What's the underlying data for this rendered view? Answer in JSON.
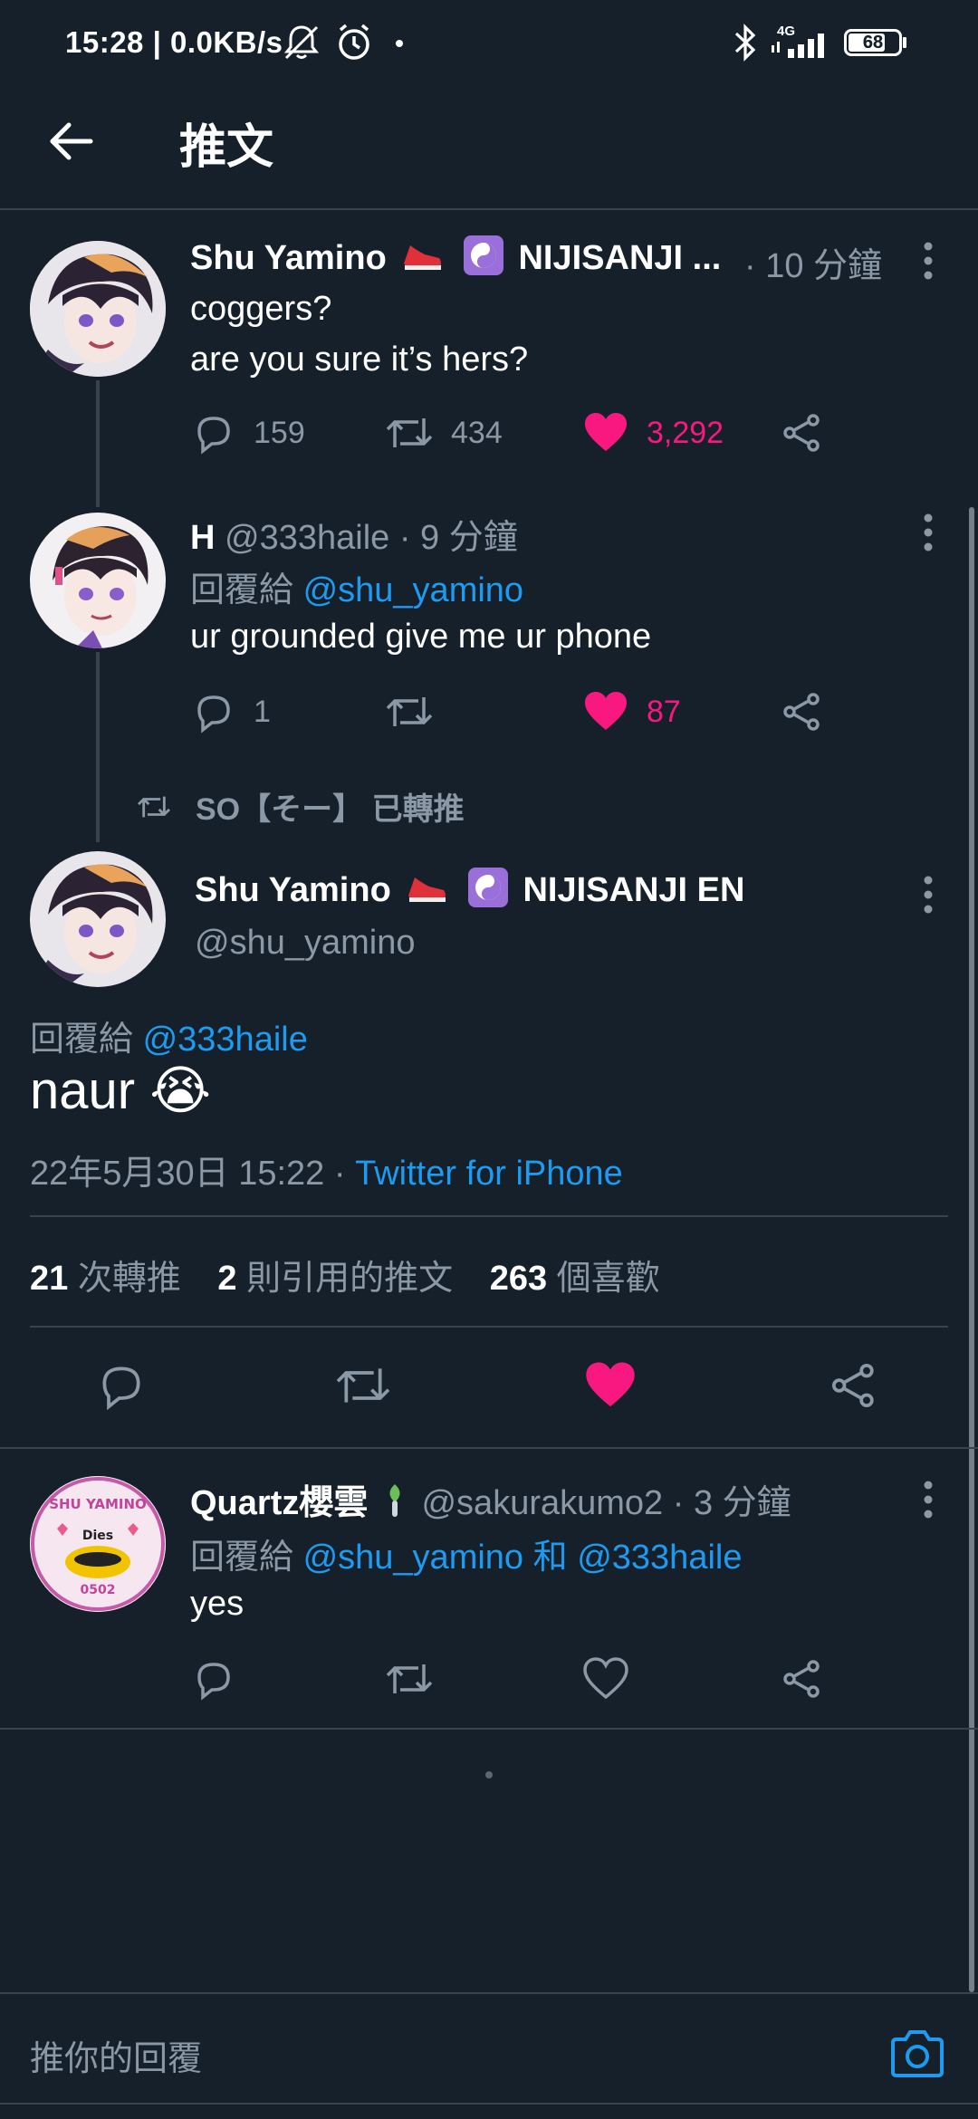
{
  "status_bar": {
    "time": "15:28 | 0.0KB/s",
    "network": "4G",
    "battery": "68"
  },
  "header": {
    "title": "推文"
  },
  "tweets": [
    {
      "name": "Shu Yamino",
      "name_suffix": "NIJISANJI ...",
      "time": "· 10 分鐘",
      "line1": "coggers?",
      "line2": "are you sure it’s hers?",
      "replies": "159",
      "retweets": "434",
      "likes": "3,292"
    },
    {
      "name": "H",
      "handle": "@333haile",
      "time": "· 9 分鐘",
      "reply_prefix": "回覆給",
      "reply_to": "@shu_yamino",
      "text": "ur grounded give me ur phone",
      "replies": "1",
      "likes": "87"
    }
  ],
  "retweet_banner": "SO【そー】 已轉推",
  "main_tweet": {
    "name": "Shu Yamino",
    "name_suffix": "NIJISANJI EN",
    "handle": "@shu_yamino",
    "reply_prefix": "回覆給",
    "reply_to": "@333haile",
    "text": "naur",
    "emoji": "😭",
    "date": "22年5月30日 15:22 ·",
    "source": "Twitter for iPhone",
    "stats": {
      "retweets_count": "21",
      "retweets_label": "次轉推",
      "quotes_count": "2",
      "quotes_label": "則引用的推文",
      "likes_count": "263",
      "likes_label": "個喜歡"
    }
  },
  "reply_tweet": {
    "name": "Quartz櫻雲",
    "handle": "@sakurakumo2",
    "time": "· 3 分鐘",
    "reply_prefix": "回覆給",
    "reply_to1": "@shu_yamino",
    "reply_and": "和",
    "reply_to2": "@333haile",
    "text": "yes",
    "avatar_text_top": "SHU YAMINO",
    "avatar_text_mid": "Dies",
    "avatar_text_bottom": "0502"
  },
  "composer": {
    "placeholder": "推你的回覆"
  },
  "colors": {
    "background": "#15202b",
    "accent": "#1d9bf0",
    "like": "#f91880",
    "muted": "#8b98a5",
    "divider": "#38444d"
  }
}
